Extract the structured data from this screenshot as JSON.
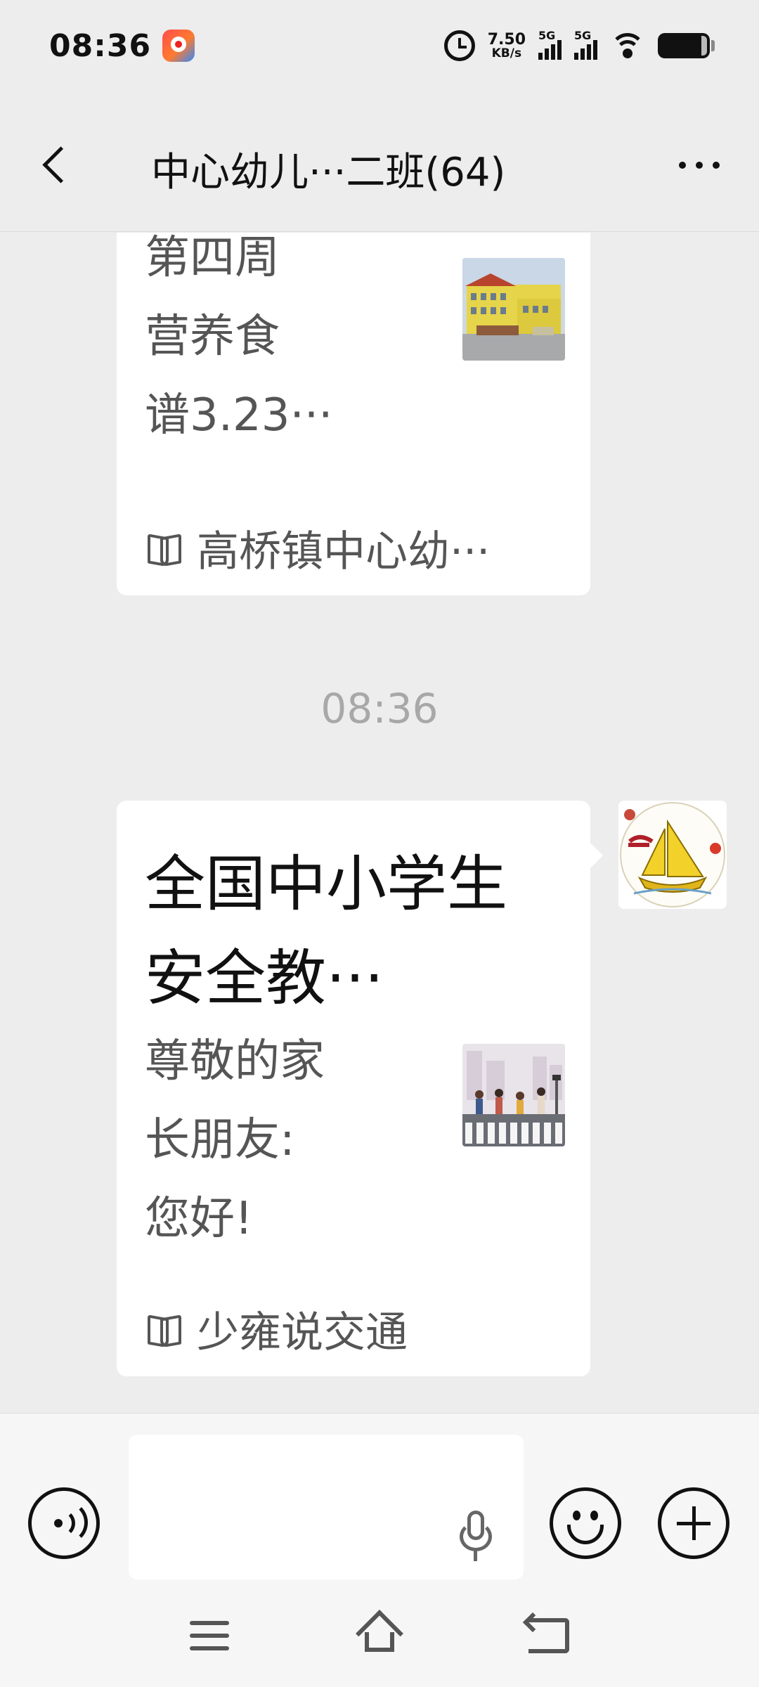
{
  "status_bar": {
    "time": "08:36",
    "net_speed_value": "7.50",
    "net_speed_unit": "KB/s",
    "sim1_label": "5G",
    "sim2_label": "5G",
    "icons": [
      "app-notification-icon",
      "alarm-icon",
      "signal-icon",
      "signal-icon",
      "wifi-icon",
      "battery-icon"
    ]
  },
  "header": {
    "title": "中心幼儿···二班(64)"
  },
  "messages": [
    {
      "type": "article-card",
      "description": "第四周\n营养食\n谱3.23···",
      "source": "高桥镇中心幼···",
      "thumbnail_icon": "school-building-image"
    },
    {
      "type": "timestamp",
      "text": "08:36"
    },
    {
      "type": "article-card",
      "headline": "全国中小学生安全教···",
      "description": "尊敬的家\n长朋友:\n您好!",
      "source": "少雍说交通",
      "thumbnail_icon": "crosswalk-children-image",
      "sender_avatar_icon": "sailboat-avatar"
    }
  ],
  "input_bar": {
    "placeholder": "",
    "icons": [
      "voice-icon",
      "mic-icon",
      "emoji-icon",
      "plus-icon"
    ]
  },
  "nav_bar": {
    "icons": [
      "menu-icon",
      "home-icon",
      "back-icon"
    ]
  },
  "colors": {
    "background": "#ededed",
    "card": "#ffffff",
    "timestamp": "#a8a8a8"
  }
}
